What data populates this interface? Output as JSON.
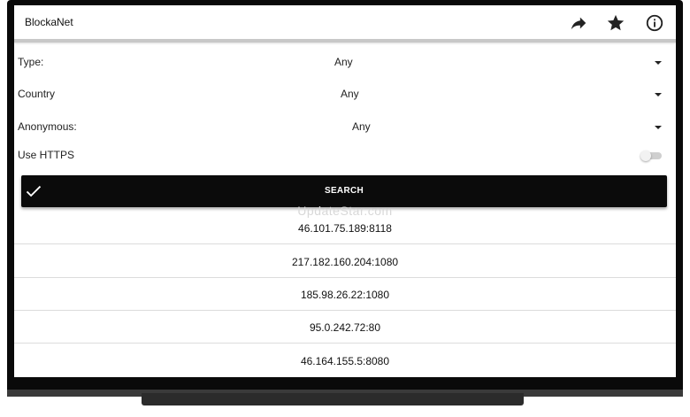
{
  "app": {
    "title": "BlockaNet"
  },
  "appbar": {
    "icons": [
      "share-icon",
      "star-icon",
      "info-icon"
    ]
  },
  "filters": {
    "type": {
      "label": "Type:",
      "value": "Any"
    },
    "country": {
      "label": "Country",
      "value": "Any"
    },
    "anonymous": {
      "label": "Anonymous:",
      "value": "Any"
    },
    "https": {
      "label": "Use HTTPS",
      "enabled": false
    }
  },
  "search": {
    "label": "SEARCH"
  },
  "watermark": "UpdateStar.com",
  "proxies": [
    "46.101.75.189:8118",
    "217.182.160.204:1080",
    "185.98.26.22:1080",
    "95.0.242.72:80",
    "46.164.155.5:8080"
  ],
  "colors": {
    "button_bg": "#0b0b0b",
    "button_text": "#ffffff",
    "device_frame": "#0a0a0a",
    "toggle_track": "#cfcfcf"
  }
}
